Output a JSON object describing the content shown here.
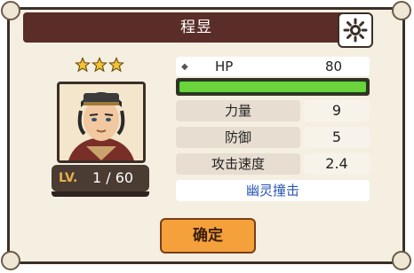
{
  "dialog": {
    "title": "程昱",
    "close_icon": "gear-close-icon",
    "stars": 3,
    "level_label": "LV.",
    "level_value": "1 / 60",
    "hp": {
      "label": "HP",
      "value": "80",
      "bar_fraction": 1.0
    },
    "stats": [
      {
        "label": "力量",
        "value": "9"
      },
      {
        "label": "防御",
        "value": "5"
      },
      {
        "label": "攻击速度",
        "value": "2.4"
      }
    ],
    "skill": "幽灵撞击",
    "confirm_label": "确定",
    "colors": {
      "title_bar": "#5a2d28",
      "hp_fill": "#6bd33c",
      "confirm": "#f5a13b",
      "skill_text": "#2a56b3"
    }
  }
}
